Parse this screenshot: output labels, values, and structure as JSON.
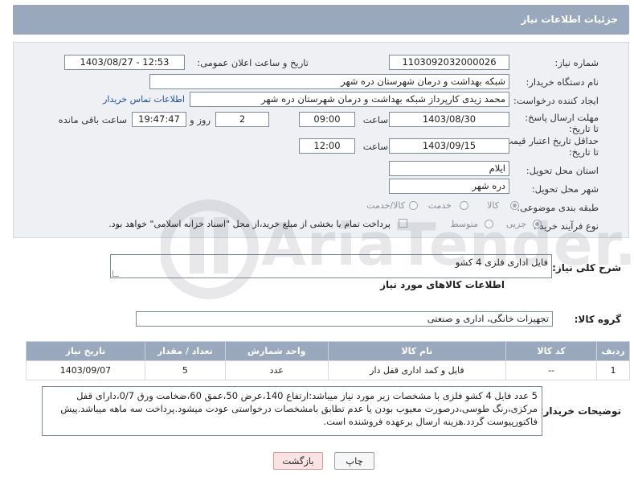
{
  "header": {
    "title": "جزئیات اطلاعات نیاز"
  },
  "labels": {
    "need_number": "شماره نیاز:",
    "announce_datetime": "تاریخ و ساعت اعلان عمومی:",
    "buyer_org": "نام دستگاه خریدار:",
    "requester": "ایجاد کننده درخواست:",
    "contact_link": "اطلاعات تماس خریدار",
    "response_deadline": "مهلت ارسال پاسخ: تا تاریخ:",
    "price_validity": "حداقل تاریخ اعتبار قیمت: تا تاریخ:",
    "time": "ساعت",
    "day_and": "روز و",
    "hours_remaining": "ساعت باقی مانده",
    "province": "استان محل تحویل:",
    "city": "شهر محل تحویل:",
    "category": "طبقه بندی موضوعی:",
    "purchase_type": "نوع فرآیند خرید :",
    "general_desc": "شرح کلی نیاز:",
    "goods_info": "اطلاعات کالاهای مورد نیاز",
    "goods_group": "گروه کالا:",
    "buyer_notes": "توضیحات خریدار:"
  },
  "values": {
    "need_number": "1103092032000026",
    "announce_datetime": "1403/08/27 - 12:53",
    "buyer_org": "شبکه بهداشت و درمان شهرستان دره شهر",
    "requester": "محمد زیدی کارپرداز شبکه بهداشت و درمان شهرستان دره شهر",
    "response_date": "1403/08/30",
    "response_time": "09:00",
    "days_remaining": "2",
    "time_remaining": "19:47:47",
    "validity_date": "1403/09/15",
    "validity_time": "12:00",
    "province": "ایلام",
    "city": "دره شهر",
    "general_desc": "فایل اداری فلزی 4 کشو",
    "goods_group": "تجهیزات خانگی، اداری و صنعتی",
    "buyer_notes": "5 عدد فایل 4 کشو فلزی با مشخصات زیر مورد نیاز میباشد:ارتفاع 140،عرض 50،عمق 60،ضخامت ورق 0/7،دارای قفل مرکزی،رنگ طوسی،درصورت معیوب بودن یا عدم تطابق بامشخصات درخواستی عودت میشود.پرداخت سه ماهه میباشد.پیش فاکتورپیوست گردد.هزینه ارسال برعهده فروشنده است."
  },
  "category_options": [
    {
      "label": "کالا",
      "selected": true
    },
    {
      "label": "خدمت",
      "selected": false
    },
    {
      "label": "کالا/خدمت",
      "selected": false
    }
  ],
  "purchase_options": [
    {
      "label": "جزیی",
      "selected": true
    },
    {
      "label": "متوسط",
      "selected": false
    }
  ],
  "payment_note": "پرداخت تمام یا بخشی از مبلغ خرید،از محل \"اسناد خزانه اسلامی\" خواهد بود.",
  "table": {
    "headers": [
      "ردیف",
      "کد کالا",
      "نام کالا",
      "واحد شمارش",
      "تعداد / مقدار",
      "تاریخ نیاز"
    ],
    "rows": [
      [
        "1",
        "--",
        "فایل و کمد اداری قفل دار",
        "عدد",
        "5",
        "1403/09/07"
      ]
    ]
  },
  "buttons": {
    "back": "بازگشت",
    "print": "چاپ"
  },
  "watermark": "AriaTender.neT",
  "colors": {
    "header_bg": "#9aa8bd",
    "panel_bg": "#eef0f3",
    "link": "#1f4fa8",
    "back_button_bg": "#fbe3e3"
  }
}
